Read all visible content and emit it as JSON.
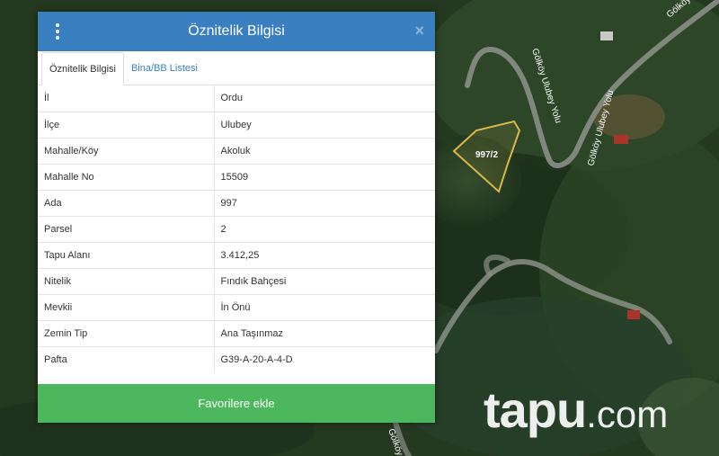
{
  "map": {
    "road_labels": [
      "Gölköy",
      "Gölköy Ulubey Yolu",
      "Gölköy Ulubey Yolu",
      "Gölköy"
    ],
    "parcel_label": "997/2",
    "parcel_color": "#d9b84a"
  },
  "panel": {
    "title": "Öznitelik Bilgisi",
    "close_label": "×",
    "tabs": [
      {
        "label": "Öznitelik Bilgisi",
        "active": true
      },
      {
        "label": "Bina/BB Listesi",
        "active": false
      }
    ],
    "rows": [
      {
        "key": "İl",
        "value": "Ordu"
      },
      {
        "key": "İlçe",
        "value": "Ulubey"
      },
      {
        "key": "Mahalle/Köy",
        "value": "Akoluk"
      },
      {
        "key": "Mahalle No",
        "value": "15509"
      },
      {
        "key": "Ada",
        "value": "997"
      },
      {
        "key": "Parsel",
        "value": "2"
      },
      {
        "key": "Tapu Alanı",
        "value": "3.412,25"
      },
      {
        "key": "Nitelik",
        "value": "Fındık Bahçesi"
      },
      {
        "key": "Mevkii",
        "value": "İn Önü"
      },
      {
        "key": "Zemin Tip",
        "value": "Ana Taşınmaz"
      },
      {
        "key": "Pafta",
        "value": "G39-A-20-A-4-D"
      }
    ],
    "favorite_button": "Favorilere ekle",
    "header_color": "#3a7fc0",
    "button_color": "#4cb75c"
  },
  "watermark": {
    "main": "tapu",
    "suffix": ".com"
  }
}
